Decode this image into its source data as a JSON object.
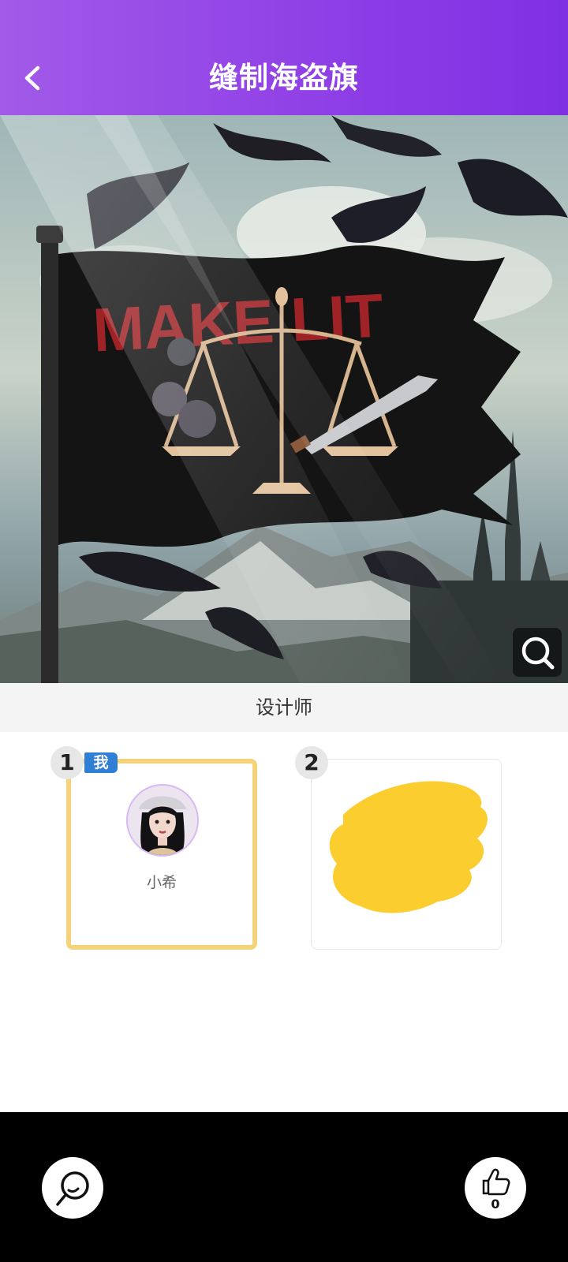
{
  "header": {
    "title": "缝制海盗旗",
    "back_icon": "chevron-left-icon"
  },
  "hero": {
    "flag_text": "MAKE LIT",
    "zoom_icon": "search-icon"
  },
  "designers": {
    "section_label": "设计师",
    "slots": [
      {
        "rank": "1",
        "tag": "我",
        "name": "小希",
        "highlight_color": "#f4d37a"
      },
      {
        "rank": "2",
        "fill_color": "#fbcd2f"
      }
    ]
  },
  "footer": {
    "comment_icon": "comment-icon",
    "like_icon": "thumbs-up-icon",
    "like_count": "0"
  },
  "colors": {
    "header_start": "#a25ae8",
    "header_end": "#8030e3",
    "me_tag": "#2f7fd6",
    "bottom_bar": "#000000"
  }
}
